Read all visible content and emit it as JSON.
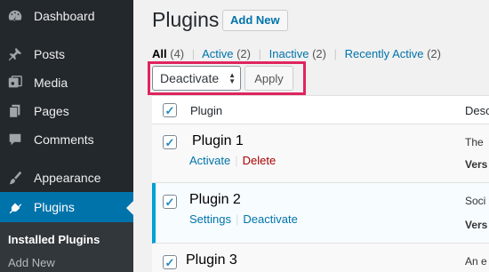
{
  "sidebar": {
    "items": [
      {
        "label": "Dashboard",
        "icon": "dashboard-icon"
      },
      {
        "label": "Posts",
        "icon": "pin-icon"
      },
      {
        "label": "Media",
        "icon": "media-icon"
      },
      {
        "label": "Pages",
        "icon": "pages-icon"
      },
      {
        "label": "Comments",
        "icon": "comments-icon"
      },
      {
        "label": "Appearance",
        "icon": "paintbrush-icon"
      },
      {
        "label": "Plugins",
        "icon": "plugin-icon"
      }
    ],
    "submenu": [
      {
        "label": "Installed Plugins"
      },
      {
        "label": "Add New"
      }
    ],
    "active_color": "#0073aa"
  },
  "header": {
    "title": "Plugins",
    "add_new": "Add New"
  },
  "filters": {
    "all_label": "All",
    "all_count": "(4)",
    "active_label": "Active",
    "active_count": "(2)",
    "inactive_label": "Inactive",
    "inactive_count": "(2)",
    "recent_label": "Recently Active",
    "recent_count": "(2)",
    "separator": "|"
  },
  "bulk": {
    "selected": "Deactivate",
    "apply": "Apply"
  },
  "table": {
    "header_plugin": "Plugin",
    "header_desc": "Desc",
    "rows": [
      {
        "name": "Plugin 1",
        "action1": "Activate",
        "action2": "Delete",
        "desc1": "The",
        "desc2": "Vers"
      },
      {
        "name": "Plugin 2",
        "action1": "Settings",
        "action2": "Deactivate",
        "desc1": "Soci",
        "desc2": "Vers"
      },
      {
        "name": "Plugin 3",
        "desc1": "An e"
      }
    ]
  },
  "highlight_color": "#e0245e"
}
